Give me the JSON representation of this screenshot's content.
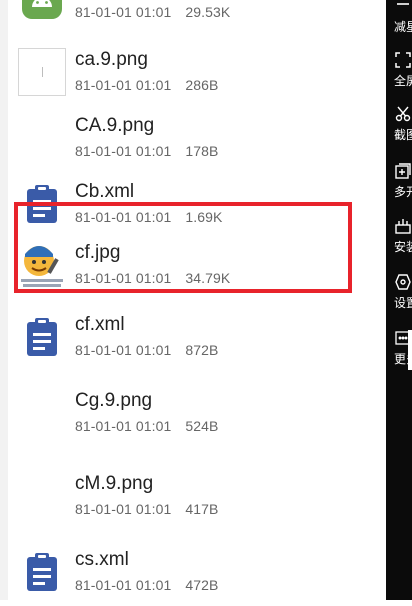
{
  "files": [
    {
      "name": "",
      "date": "81-01-01 01:01",
      "size": "29.53K",
      "icon": "android-icon"
    },
    {
      "name": "ca.9.png",
      "date": "81-01-01 01:01",
      "size": "286B",
      "icon": "image-thumb"
    },
    {
      "name": "CA.9.png",
      "date": "81-01-01 01:01",
      "size": "178B",
      "icon": "none"
    },
    {
      "name": "Cb.xml",
      "date": "81-01-01 01:01",
      "size": "1.69K",
      "icon": "clipboard-doc-icon"
    },
    {
      "name": "cf.jpg",
      "date": "81-01-01 01:01",
      "size": "34.79K",
      "icon": "photo-thumb"
    },
    {
      "name": "cf.xml",
      "date": "81-01-01 01:01",
      "size": "872B",
      "icon": "clipboard-doc-icon"
    },
    {
      "name": "Cg.9.png",
      "date": "81-01-01 01:01",
      "size": "524B",
      "icon": "none"
    },
    {
      "name": "cM.9.png",
      "date": "81-01-01 01:01",
      "size": "417B",
      "icon": "none"
    },
    {
      "name": "cs.xml",
      "date": "81-01-01 01:01",
      "size": "472B",
      "icon": "clipboard-doc-icon"
    }
  ],
  "sidebar": [
    {
      "label": "减星",
      "icon": "minus-icon"
    },
    {
      "label": "全屏",
      "icon": "fullscreen-icon"
    },
    {
      "label": "截图",
      "icon": "scissors-icon"
    },
    {
      "label": "多开",
      "icon": "multi-window-icon"
    },
    {
      "label": "安装",
      "icon": "install-icon"
    },
    {
      "label": "设置",
      "icon": "settings-icon"
    },
    {
      "label": "更多",
      "icon": "more-icon"
    }
  ],
  "colors": {
    "highlight": "#e8232b",
    "file_icon": "#3a5ba8",
    "sidebar_bg": "#0b0b0b"
  }
}
